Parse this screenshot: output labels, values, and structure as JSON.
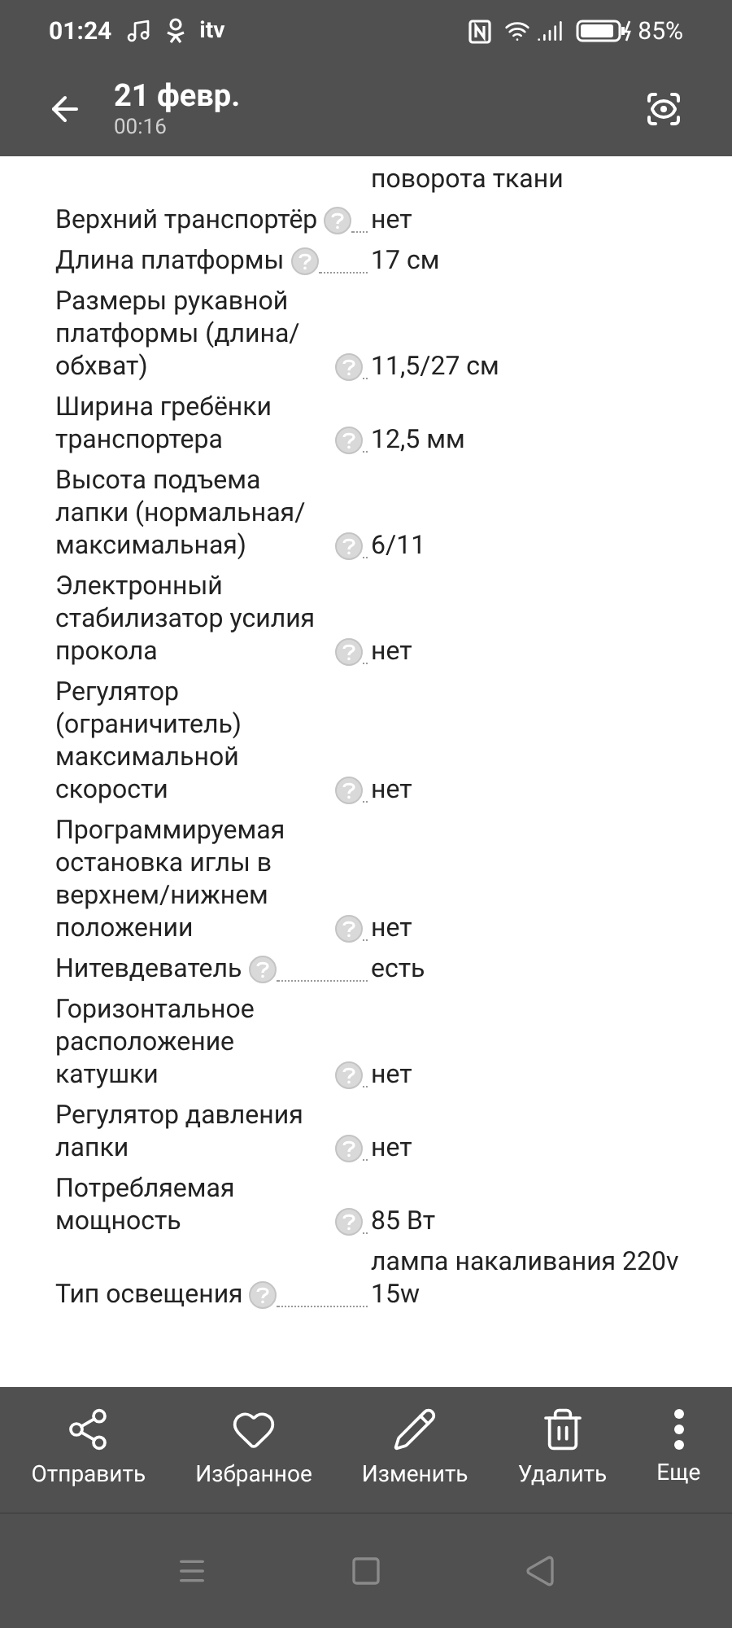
{
  "status_bar": {
    "time": "01:24",
    "app_label": "itv",
    "battery": "85%"
  },
  "header": {
    "title": "21 февр.",
    "subtitle": "00:16"
  },
  "specs": [
    {
      "value": "поворота ткани",
      "help": false
    },
    {
      "label": "Верхний транспортёр",
      "value": "нет",
      "help": true
    },
    {
      "label": "Длина платформы",
      "value": "17 см",
      "help": true
    },
    {
      "label": "Размеры рукавной платформы (длина/обхват)",
      "value": "11,5/27 см",
      "help": true
    },
    {
      "label": "Ширина гребёнки транспортера",
      "value": "12,5 мм",
      "help": true
    },
    {
      "label": "Высота подъема лапки (нормальная/максимальная)",
      "value": "6/11",
      "help": true
    },
    {
      "label": "Электронный стабилизатор усилия прокола",
      "value": "нет",
      "help": true
    },
    {
      "label": "Регулятор (ограничитель) максимальной скорости",
      "value": "нет",
      "help": true
    },
    {
      "label": "Программируемая остановка иглы в верхнем/нижнем положении",
      "value": "нет",
      "help": true
    },
    {
      "label": "Нитевдеватель",
      "value": "есть",
      "help": true
    },
    {
      "label": "Горизонтальное расположение катушки",
      "value": "нет",
      "help": true
    },
    {
      "label": "Регулятор давления лапки",
      "value": "нет",
      "help": true
    },
    {
      "label": "Потребляемая мощность",
      "value": "85 Вт",
      "help": true
    },
    {
      "label": "Тип освещения",
      "value": "лампа накаливания 220v 15w",
      "help": true
    }
  ],
  "actions": [
    {
      "kind": "share",
      "label": "Отправить"
    },
    {
      "kind": "favorite",
      "label": "Избранное"
    },
    {
      "kind": "edit",
      "label": "Изменить"
    },
    {
      "kind": "delete",
      "label": "Удалить"
    },
    {
      "kind": "more",
      "label": "Еще"
    }
  ]
}
